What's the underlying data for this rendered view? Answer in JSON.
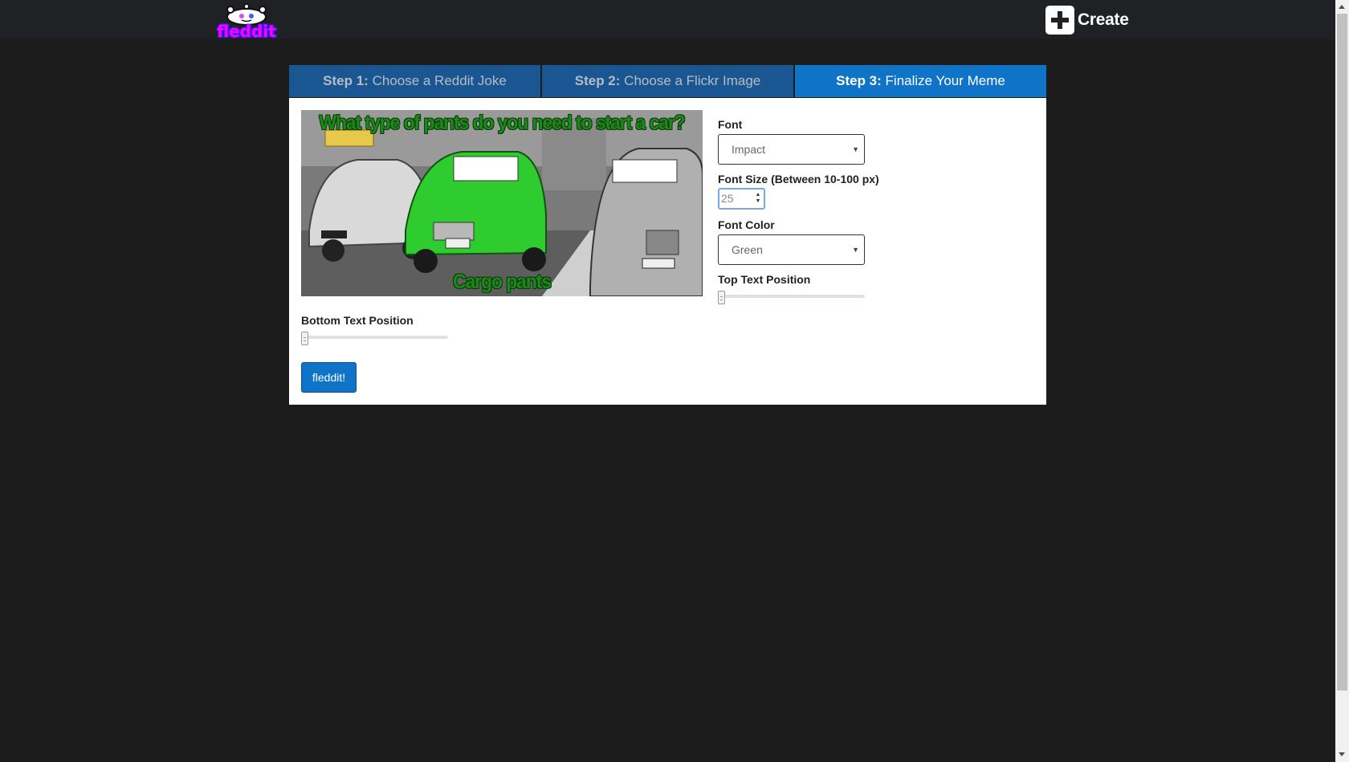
{
  "header": {
    "logo_text": "fleddit",
    "create_label": "Create"
  },
  "tabs": [
    {
      "step": "Step 1:",
      "label": "Choose a Reddit Joke",
      "active": false
    },
    {
      "step": "Step 2:",
      "label": "Choose a Flickr Image",
      "active": false
    },
    {
      "step": "Step 3:",
      "label": "Finalize Your Meme",
      "active": true
    }
  ],
  "meme": {
    "top_text": "What type of pants do you need to start a car?",
    "bottom_text": "Cargo pants",
    "text_color": "#1c8a19"
  },
  "form": {
    "font_label": "Font",
    "font_value": "Impact",
    "font_size_label": "Font Size (Between 10-100 px)",
    "font_size_value": "25",
    "font_color_label": "Font Color",
    "font_color_value": "Green",
    "top_position_label": "Top Text Position",
    "bottom_position_label": "Bottom Text Position",
    "submit_label": "fleddit!"
  },
  "colors": {
    "accent": "#0f74c7",
    "tab_inactive": "#1a5792",
    "background": "#1c1c1d"
  }
}
